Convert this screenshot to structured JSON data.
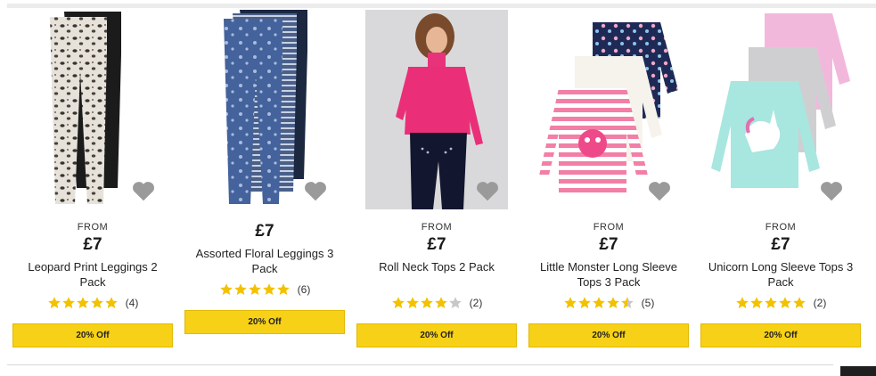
{
  "products": [
    {
      "from_label": "FROM",
      "price": "£7",
      "name": "Leopard Print Leggings 2 Pack",
      "rating": 5,
      "review_count": "(4)",
      "offer": "20% Off",
      "image": "leopard-leggings"
    },
    {
      "from_label": "",
      "price": "£7",
      "name": "Assorted Floral Leggings 3 Pack",
      "rating": 5,
      "review_count": "(6)",
      "offer": "20% Off",
      "image": "floral-leggings"
    },
    {
      "from_label": "FROM",
      "price": "£7",
      "name": "Roll Neck Tops 2 Pack",
      "rating": 4,
      "review_count": "(2)",
      "offer": "20% Off",
      "image": "roll-neck-top"
    },
    {
      "from_label": "FROM",
      "price": "£7",
      "name": "Little Monster Long Sleeve Tops 3 Pack",
      "rating": 4.5,
      "review_count": "(5)",
      "offer": "20% Off",
      "image": "monster-tops"
    },
    {
      "from_label": "FROM",
      "price": "£7",
      "name": "Unicorn Long Sleeve Tops 3 Pack",
      "rating": 5,
      "review_count": "(2)",
      "offer": "20% Off",
      "image": "unicorn-tops"
    }
  ],
  "colors": {
    "offer_bg": "#f7d117",
    "star_filled": "#f2c200",
    "star_empty": "#c8c8c8",
    "heart": "#9a9a9a"
  }
}
